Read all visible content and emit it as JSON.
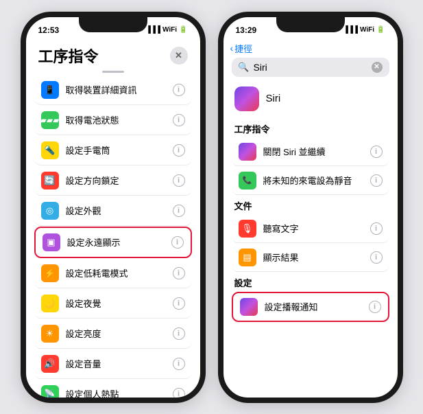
{
  "left_phone": {
    "status_time": "12:53",
    "title": "工序指令",
    "close_label": "✕",
    "menu_items": [
      {
        "id": "get-device",
        "label": "取得裝置詳細資訊",
        "icon_color": "blue",
        "icon_char": "📱",
        "highlighted": false
      },
      {
        "id": "get-battery",
        "label": "取得電池狀態",
        "icon_color": "green",
        "icon_char": "🔋",
        "highlighted": false
      },
      {
        "id": "set-flashlight",
        "label": "設定手電筒",
        "icon_color": "yellow",
        "icon_char": "🔦",
        "highlighted": false
      },
      {
        "id": "set-orientation",
        "label": "設定方向鎖定",
        "icon_color": "red",
        "icon_char": "🔄",
        "highlighted": false
      },
      {
        "id": "set-appearance",
        "label": "設定外觀",
        "icon_color": "cyan",
        "icon_char": "⚙️",
        "highlighted": false
      },
      {
        "id": "set-always-on",
        "label": "設定永遠顯示",
        "icon_color": "purple",
        "icon_char": "📺",
        "highlighted": true
      },
      {
        "id": "set-low-power",
        "label": "設定低耗電模式",
        "icon_color": "orange",
        "icon_char": "🔋",
        "highlighted": false
      },
      {
        "id": "set-night",
        "label": "設定夜覺",
        "icon_color": "yellow",
        "icon_char": "🌙",
        "highlighted": false
      },
      {
        "id": "set-brightness",
        "label": "設定亮度",
        "icon_color": "orange",
        "icon_char": "☀️",
        "highlighted": false
      },
      {
        "id": "set-volume",
        "label": "設定音量",
        "icon_color": "red",
        "icon_char": "🔊",
        "highlighted": false
      },
      {
        "id": "set-hotspot",
        "label": "設定個人熱點",
        "icon_color": "green2",
        "icon_char": "📡",
        "highlighted": false
      }
    ]
  },
  "right_phone": {
    "status_time": "13:29",
    "back_label": "捷徑",
    "search_placeholder": "Siri",
    "search_value": "Siri",
    "siri_name": "Siri",
    "sections": [
      {
        "header": "工序指令",
        "items": [
          {
            "id": "close-siri",
            "label": "關閉 Siri 並繼續",
            "icon_color": "siri",
            "highlighted": false
          },
          {
            "id": "set-unknown-silent",
            "label": "將未知的來電設為靜音",
            "icon_color": "green",
            "highlighted": false
          }
        ]
      },
      {
        "header": "文件",
        "items": [
          {
            "id": "dictate",
            "label": "聽寫文字",
            "icon_color": "red",
            "highlighted": false
          },
          {
            "id": "show-result",
            "label": "顯示結果",
            "icon_color": "orange",
            "highlighted": false
          }
        ]
      },
      {
        "header": "設定",
        "items": [
          {
            "id": "set-broadcast",
            "label": "設定播報通知",
            "icon_color": "siri",
            "highlighted": true
          }
        ]
      }
    ]
  },
  "icons": {
    "info": "ⓘ",
    "search": "🔍",
    "chevron_left": "‹",
    "siri_emoji": "🎙"
  }
}
